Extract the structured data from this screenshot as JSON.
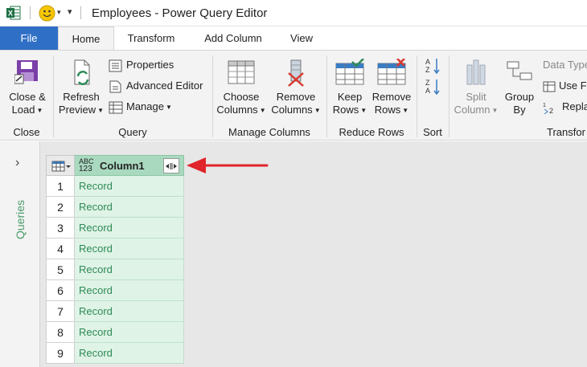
{
  "window": {
    "title": "Employees - Power Query Editor"
  },
  "tabs": [
    {
      "label": "File"
    },
    {
      "label": "Home"
    },
    {
      "label": "Transform"
    },
    {
      "label": "Add Column"
    },
    {
      "label": "View"
    }
  ],
  "ribbon": {
    "close_group": {
      "label": "Close",
      "close_load": [
        "Close &",
        "Load"
      ]
    },
    "query_group": {
      "label": "Query",
      "refresh": [
        "Refresh",
        "Preview"
      ],
      "properties": "Properties",
      "advanced_editor": "Advanced Editor",
      "manage": "Manage"
    },
    "manage_columns_group": {
      "label": "Manage Columns",
      "choose": [
        "Choose",
        "Columns"
      ],
      "remove": [
        "Remove",
        "Columns"
      ]
    },
    "reduce_rows_group": {
      "label": "Reduce Rows",
      "keep": [
        "Keep",
        "Rows"
      ],
      "remove": [
        "Remove",
        "Rows"
      ]
    },
    "sort_group": {
      "label": "Sort"
    },
    "transform_group": {
      "label": "Transfor",
      "split": [
        "Split",
        "Column"
      ],
      "group_by": [
        "Group",
        "By"
      ],
      "data_type": "Data Type",
      "use_first_row": "Use F",
      "replace": "Repla"
    }
  },
  "querypane": {
    "label": "Queries"
  },
  "grid": {
    "type_label_top": "ABC",
    "type_label_bottom": "123",
    "column_name": "Column1",
    "rows": [
      {
        "n": "1",
        "value": "Record"
      },
      {
        "n": "2",
        "value": "Record"
      },
      {
        "n": "3",
        "value": "Record"
      },
      {
        "n": "4",
        "value": "Record"
      },
      {
        "n": "5",
        "value": "Record"
      },
      {
        "n": "6",
        "value": "Record"
      },
      {
        "n": "7",
        "value": "Record"
      },
      {
        "n": "8",
        "value": "Record"
      },
      {
        "n": "9",
        "value": "Record"
      }
    ]
  },
  "colors": {
    "file_tab": "#2f6fc6",
    "column_header": "#a9d9bf",
    "cell_bg": "#dff3e6",
    "record_text": "#2e8b57",
    "annotation_arrow": "#e0242b"
  }
}
